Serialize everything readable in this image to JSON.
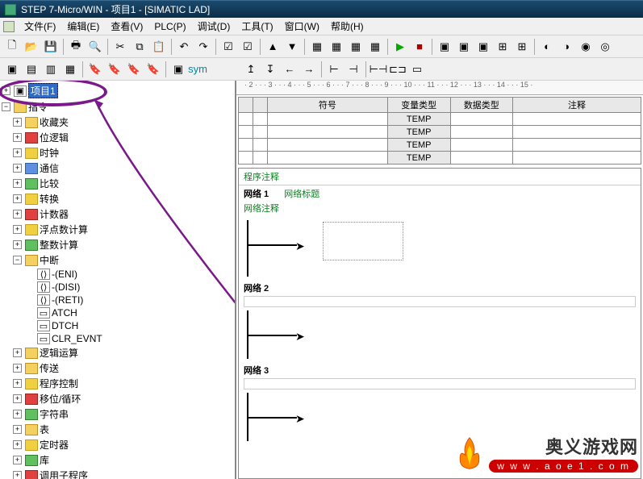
{
  "title": "STEP 7-Micro/WIN - 项目1 - [SIMATIC LAD]",
  "menu": {
    "file": "文件(F)",
    "edit": "编辑(E)",
    "view": "查看(V)",
    "plc": "PLC(P)",
    "debug": "调试(D)",
    "tools": "工具(T)",
    "window": "窗口(W)",
    "help": "帮助(H)"
  },
  "tree": {
    "root": "项目1",
    "instr": "指令",
    "items": [
      "收藏夹",
      "位逻辑",
      "时钟",
      "通信",
      "比较",
      "转换",
      "计数器",
      "浮点数计算",
      "整数计算",
      "中断"
    ],
    "interrupt": [
      "-(ENI)",
      "-(DISI)",
      "-(RETI)",
      "ATCH",
      "DTCH",
      "CLR_EVNT"
    ],
    "items2": [
      "逻辑运算",
      "传送",
      "程序控制",
      "移位/循环",
      "字符串",
      "表",
      "定时器",
      "库",
      "调用子程序"
    ]
  },
  "ruler_text": "· 2 · · · 3 · · · 4 · · · 5 · · · 6 · · · 7 · · · 8 · · · 9 · · · 10 · · · 11 · · · 12 · · · 13 · · · 14 · · · 15 ·",
  "vartable": {
    "headers": {
      "symbol": "符号",
      "type": "变量类型",
      "datatype": "数据类型",
      "comment": "注释"
    },
    "temp": "TEMP"
  },
  "ladder": {
    "prog_comment": "程序注释",
    "net1": "网络 1",
    "net1_label": "网络标题",
    "net1_comment": "网络注释",
    "net2": "网络 2",
    "net3": "网络 3"
  },
  "watermark": {
    "cn": "奥义游戏网",
    "url": "w w w . a o e 1 . c o m"
  }
}
